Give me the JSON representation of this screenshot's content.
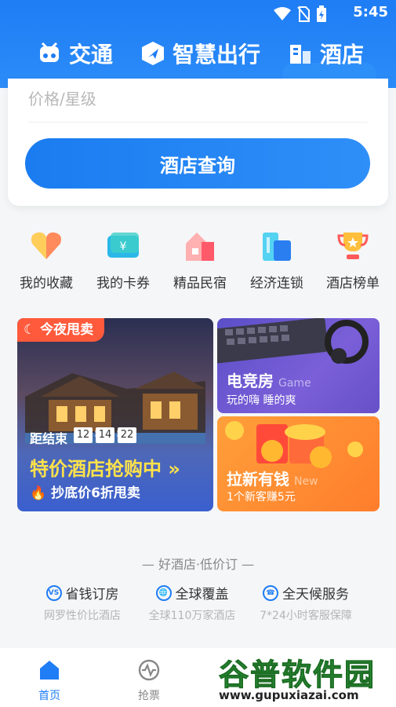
{
  "status": {
    "time": "5:45"
  },
  "tabs": [
    {
      "label": "交通",
      "icon": "train-icon"
    },
    {
      "label": "智慧出行",
      "icon": "compass-icon"
    },
    {
      "label": "酒店",
      "icon": "hotel-icon"
    }
  ],
  "search": {
    "price_placeholder": "价格/星级",
    "button_label": "酒店查询"
  },
  "quick": [
    {
      "label": "我的收藏",
      "icon": "heart-icon"
    },
    {
      "label": "我的卡券",
      "icon": "coupon-icon"
    },
    {
      "label": "精品民宿",
      "icon": "house-icon"
    },
    {
      "label": "经济连锁",
      "icon": "building-icon"
    },
    {
      "label": "酒店榜单",
      "icon": "trophy-icon"
    }
  ],
  "promo_big": {
    "tag": "今夜甩卖",
    "countdown_label": "距结束",
    "hours": "12",
    "minutes": "14",
    "seconds": "22",
    "title": "特价酒店抢购中",
    "arrow": "»",
    "subtitle": "抄底价6折甩卖"
  },
  "promo_r1": {
    "title": "电竞房",
    "en": "Game",
    "subtitle": "玩的嗨 睡的爽"
  },
  "promo_r2": {
    "title": "拉新有钱",
    "en": "New",
    "subtitle": "1个新客赚5元"
  },
  "slogan": "— 好酒店·低价订 —",
  "features": [
    {
      "title": "省钱订房",
      "sub": "网罗性价比酒店",
      "icon_text": "VS"
    },
    {
      "title": "全球覆盖",
      "sub": "全球110万家酒店",
      "icon_text": "🌐"
    },
    {
      "title": "全天候服务",
      "sub": "7*24小时客服保障",
      "icon_text": "☎"
    }
  ],
  "nav": [
    {
      "label": "首页",
      "icon": "home-icon"
    },
    {
      "label": "抢票",
      "icon": "pulse-icon"
    }
  ],
  "watermark": {
    "brand": "谷普软件园",
    "url": "www.gupuxiazai.com"
  },
  "colors": {
    "primary": "#1f7df5",
    "promo_tag": "#ff5a3c",
    "promo_title": "#ffe24a"
  }
}
